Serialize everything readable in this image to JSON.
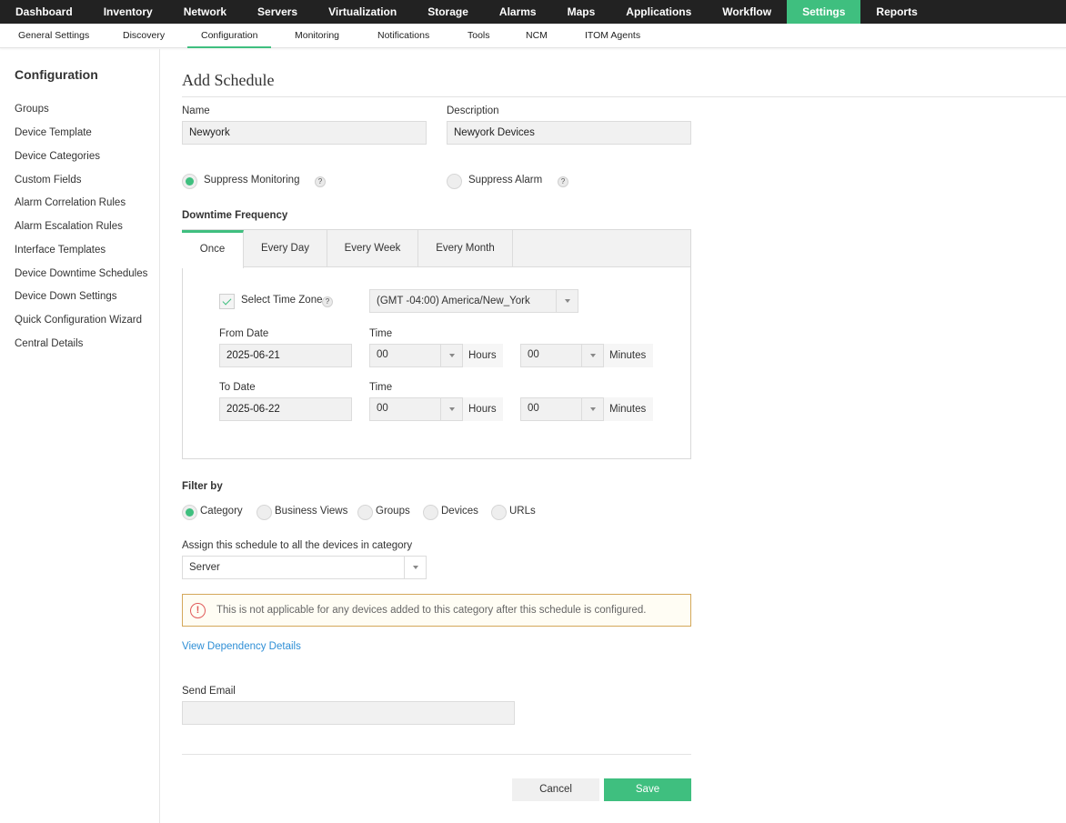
{
  "topnav": {
    "items": [
      "Dashboard",
      "Inventory",
      "Network",
      "Servers",
      "Virtualization",
      "Storage",
      "Alarms",
      "Maps",
      "Applications",
      "Workflow",
      "Settings",
      "Reports"
    ],
    "active": "Settings"
  },
  "subnav": {
    "items": [
      "General Settings",
      "Discovery",
      "Configuration",
      "Monitoring",
      "Notifications",
      "Tools",
      "NCM",
      "ITOM Agents"
    ],
    "active": "Configuration"
  },
  "sidebar": {
    "title": "Configuration",
    "items": [
      "Groups",
      "Device Template",
      "Device Categories",
      "Custom Fields",
      "Alarm Correlation Rules",
      "Alarm Escalation Rules",
      "Interface Templates",
      "Device Downtime Schedules",
      "Device Down Settings",
      "Quick Configuration Wizard",
      "Central Details"
    ]
  },
  "page": {
    "title": "Add Schedule"
  },
  "form": {
    "name_label": "Name",
    "name_value": "Newyork",
    "description_label": "Description",
    "description_value": "Newyork Devices",
    "suppress_monitoring": "Suppress Monitoring",
    "suppress_alarm": "Suppress Alarm",
    "help_glyph": "?",
    "selected_suppress": "Suppress Monitoring"
  },
  "frequency": {
    "label": "Downtime Frequency",
    "tabs": [
      "Once",
      "Every Day",
      "Every Week",
      "Every Month"
    ],
    "active_tab": "Once",
    "select_timezone_label": "Select Time Zone",
    "timezone_checked": true,
    "timezone_value": "(GMT -04:00) America/New_York",
    "from_date_label": "From Date",
    "from_date": "2025-06-21",
    "to_date_label": "To Date",
    "to_date": "2025-06-22",
    "time_label": "Time",
    "from_hours": "00",
    "from_minutes": "00",
    "to_hours": "00",
    "to_minutes": "00",
    "hours_unit": "Hours",
    "minutes_unit": "Minutes"
  },
  "filter": {
    "label": "Filter by",
    "options": [
      "Category",
      "Business Views",
      "Groups",
      "Devices",
      "URLs"
    ],
    "selected": "Category",
    "assign_label": "Assign this schedule to all the devices in category",
    "category_value": "Server"
  },
  "warning": {
    "icon_glyph": "!",
    "text": "This is not applicable for any devices added to this category after this schedule is configured."
  },
  "dependency_link": "View Dependency Details",
  "email": {
    "label": "Send Email",
    "value": ""
  },
  "buttons": {
    "cancel": "Cancel",
    "save": "Save"
  },
  "colors": {
    "accent": "#3fbf7f",
    "topnav_bg": "#222222",
    "link": "#2f8fd6",
    "warning_border": "#d4a85a"
  }
}
